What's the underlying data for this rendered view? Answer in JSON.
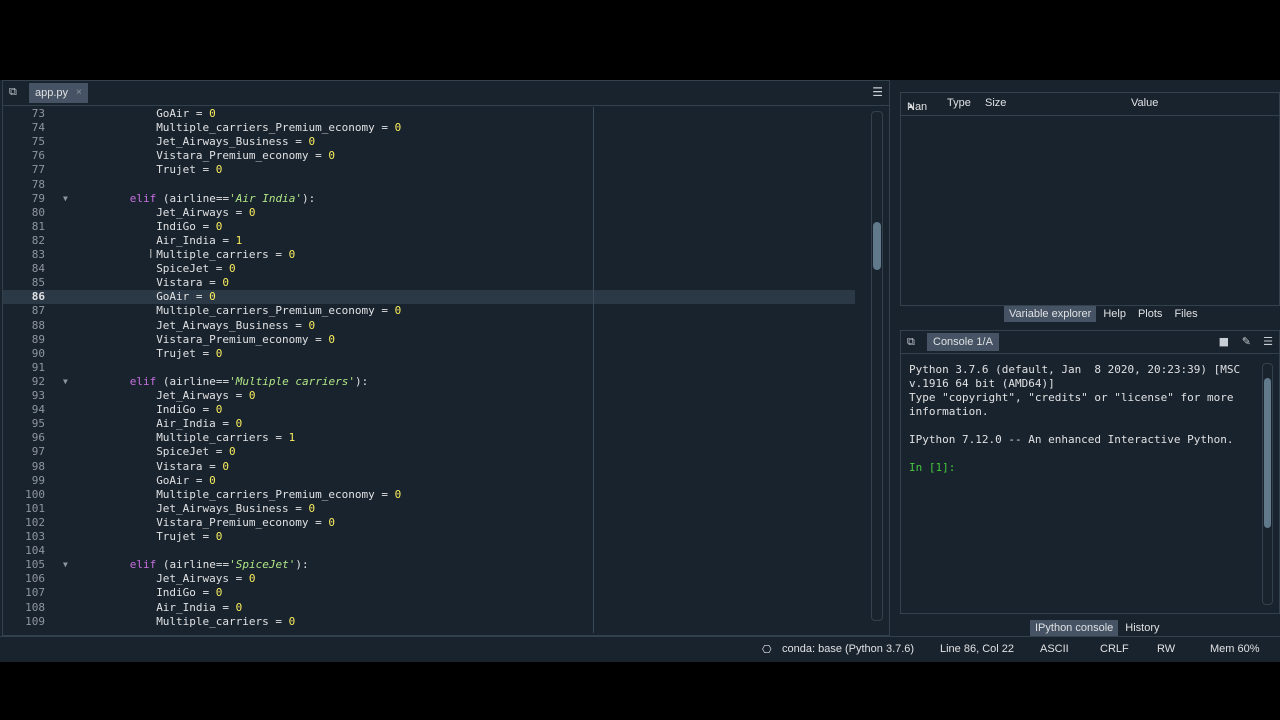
{
  "editor": {
    "tab_label": "app.py",
    "tab_close": "×",
    "lines": [
      {
        "num": "73",
        "indent": 12,
        "segs": [
          [
            "GoAir = ",
            ""
          ],
          [
            "0",
            "num"
          ]
        ]
      },
      {
        "num": "74",
        "indent": 12,
        "segs": [
          [
            "Multiple_carriers_Premium_economy = ",
            ""
          ],
          [
            "0",
            "num"
          ]
        ]
      },
      {
        "num": "75",
        "indent": 12,
        "segs": [
          [
            "Jet_Airways_Business = ",
            ""
          ],
          [
            "0",
            "num"
          ]
        ]
      },
      {
        "num": "76",
        "indent": 12,
        "segs": [
          [
            "Vistara_Premium_economy = ",
            ""
          ],
          [
            "0",
            "num"
          ]
        ]
      },
      {
        "num": "77",
        "indent": 12,
        "segs": [
          [
            "Trujet = ",
            ""
          ],
          [
            "0",
            "num"
          ]
        ]
      },
      {
        "num": "78",
        "indent": 0,
        "segs": []
      },
      {
        "num": "79",
        "indent": 8,
        "fold": true,
        "segs": [
          [
            "elif",
            "kw"
          ],
          [
            " (airline==",
            ""
          ],
          [
            "'Air India'",
            "str"
          ],
          [
            "):",
            ""
          ]
        ]
      },
      {
        "num": "80",
        "indent": 12,
        "segs": [
          [
            "Jet_Airways = ",
            ""
          ],
          [
            "0",
            "num"
          ]
        ]
      },
      {
        "num": "81",
        "indent": 12,
        "segs": [
          [
            "IndiGo = ",
            ""
          ],
          [
            "0",
            "num"
          ]
        ]
      },
      {
        "num": "82",
        "indent": 12,
        "segs": [
          [
            "Air_India = ",
            ""
          ],
          [
            "1",
            "num"
          ]
        ]
      },
      {
        "num": "83",
        "indent": 12,
        "segs": [
          [
            "Multiple_carriers = ",
            ""
          ],
          [
            "0",
            "num"
          ]
        ]
      },
      {
        "num": "84",
        "indent": 12,
        "segs": [
          [
            "SpiceJet = ",
            ""
          ],
          [
            "0",
            "num"
          ]
        ]
      },
      {
        "num": "85",
        "indent": 12,
        "segs": [
          [
            "Vistara = ",
            ""
          ],
          [
            "0",
            "num"
          ]
        ]
      },
      {
        "num": "86",
        "indent": 12,
        "current": true,
        "segs": [
          [
            "GoAir = ",
            ""
          ],
          [
            "0",
            "num"
          ]
        ]
      },
      {
        "num": "87",
        "indent": 12,
        "segs": [
          [
            "Multiple_carriers_Premium_economy = ",
            ""
          ],
          [
            "0",
            "num"
          ]
        ]
      },
      {
        "num": "88",
        "indent": 12,
        "segs": [
          [
            "Jet_Airways_Business = ",
            ""
          ],
          [
            "0",
            "num"
          ]
        ]
      },
      {
        "num": "89",
        "indent": 12,
        "segs": [
          [
            "Vistara_Premium_economy = ",
            ""
          ],
          [
            "0",
            "num"
          ]
        ]
      },
      {
        "num": "90",
        "indent": 12,
        "segs": [
          [
            "Trujet = ",
            ""
          ],
          [
            "0",
            "num"
          ]
        ]
      },
      {
        "num": "91",
        "indent": 0,
        "segs": []
      },
      {
        "num": "92",
        "indent": 8,
        "fold": true,
        "segs": [
          [
            "elif",
            "kw"
          ],
          [
            " (airline==",
            ""
          ],
          [
            "'Multiple carriers'",
            "str"
          ],
          [
            "):",
            ""
          ]
        ]
      },
      {
        "num": "93",
        "indent": 12,
        "segs": [
          [
            "Jet_Airways = ",
            ""
          ],
          [
            "0",
            "num"
          ]
        ]
      },
      {
        "num": "94",
        "indent": 12,
        "segs": [
          [
            "IndiGo = ",
            ""
          ],
          [
            "0",
            "num"
          ]
        ]
      },
      {
        "num": "95",
        "indent": 12,
        "segs": [
          [
            "Air_India = ",
            ""
          ],
          [
            "0",
            "num"
          ]
        ]
      },
      {
        "num": "96",
        "indent": 12,
        "segs": [
          [
            "Multiple_carriers = ",
            ""
          ],
          [
            "1",
            "num"
          ]
        ]
      },
      {
        "num": "97",
        "indent": 12,
        "segs": [
          [
            "SpiceJet = ",
            ""
          ],
          [
            "0",
            "num"
          ]
        ]
      },
      {
        "num": "98",
        "indent": 12,
        "segs": [
          [
            "Vistara = ",
            ""
          ],
          [
            "0",
            "num"
          ]
        ]
      },
      {
        "num": "99",
        "indent": 12,
        "segs": [
          [
            "GoAir = ",
            ""
          ],
          [
            "0",
            "num"
          ]
        ]
      },
      {
        "num": "100",
        "indent": 12,
        "segs": [
          [
            "Multiple_carriers_Premium_economy = ",
            ""
          ],
          [
            "0",
            "num"
          ]
        ]
      },
      {
        "num": "101",
        "indent": 12,
        "segs": [
          [
            "Jet_Airways_Business = ",
            ""
          ],
          [
            "0",
            "num"
          ]
        ]
      },
      {
        "num": "102",
        "indent": 12,
        "segs": [
          [
            "Vistara_Premium_economy = ",
            ""
          ],
          [
            "0",
            "num"
          ]
        ]
      },
      {
        "num": "103",
        "indent": 12,
        "segs": [
          [
            "Trujet = ",
            ""
          ],
          [
            "0",
            "num"
          ]
        ]
      },
      {
        "num": "104",
        "indent": 0,
        "segs": []
      },
      {
        "num": "105",
        "indent": 8,
        "fold": true,
        "segs": [
          [
            "elif",
            "kw"
          ],
          [
            " (airline==",
            ""
          ],
          [
            "'SpiceJet'",
            "str"
          ],
          [
            "):",
            ""
          ]
        ]
      },
      {
        "num": "106",
        "indent": 12,
        "segs": [
          [
            "Jet_Airways = ",
            ""
          ],
          [
            "0",
            "num"
          ]
        ]
      },
      {
        "num": "107",
        "indent": 12,
        "segs": [
          [
            "IndiGo = ",
            ""
          ],
          [
            "0",
            "num"
          ]
        ]
      },
      {
        "num": "108",
        "indent": 12,
        "segs": [
          [
            "Air_India = ",
            ""
          ],
          [
            "0",
            "num"
          ]
        ]
      },
      {
        "num": "109",
        "indent": 12,
        "segs": [
          [
            "Multiple_carriers = ",
            ""
          ],
          [
            "0",
            "num"
          ]
        ]
      }
    ]
  },
  "variable_explorer": {
    "columns": [
      "Nan",
      "Type",
      "Size",
      "Value"
    ],
    "tabs": [
      "Variable explorer",
      "Help",
      "Plots",
      "Files"
    ]
  },
  "console": {
    "tab_label": "Console 1/A",
    "output": "Python 3.7.6 (default, Jan  8 2020, 20:23:39) [MSC\nv.1916 64 bit (AMD64)]\nType \"copyright\", \"credits\" or \"license\" for more\ninformation.\n\nIPython 7.12.0 -- An enhanced Interactive Python.\n\n",
    "prompt": "In [1]:",
    "tabs": [
      "IPython console",
      "History"
    ]
  },
  "statusbar": {
    "env": "conda: base (Python 3.7.6)",
    "position": "Line 86, Col 22",
    "encoding": "ASCII",
    "eol": "CRLF",
    "mode": "RW",
    "mem": "Mem 60%"
  },
  "colors": {
    "background": "#19232d",
    "keyword": "#c670e0",
    "string": "#b0e686",
    "number": "#faed5c",
    "prompt": "#44c83a"
  }
}
